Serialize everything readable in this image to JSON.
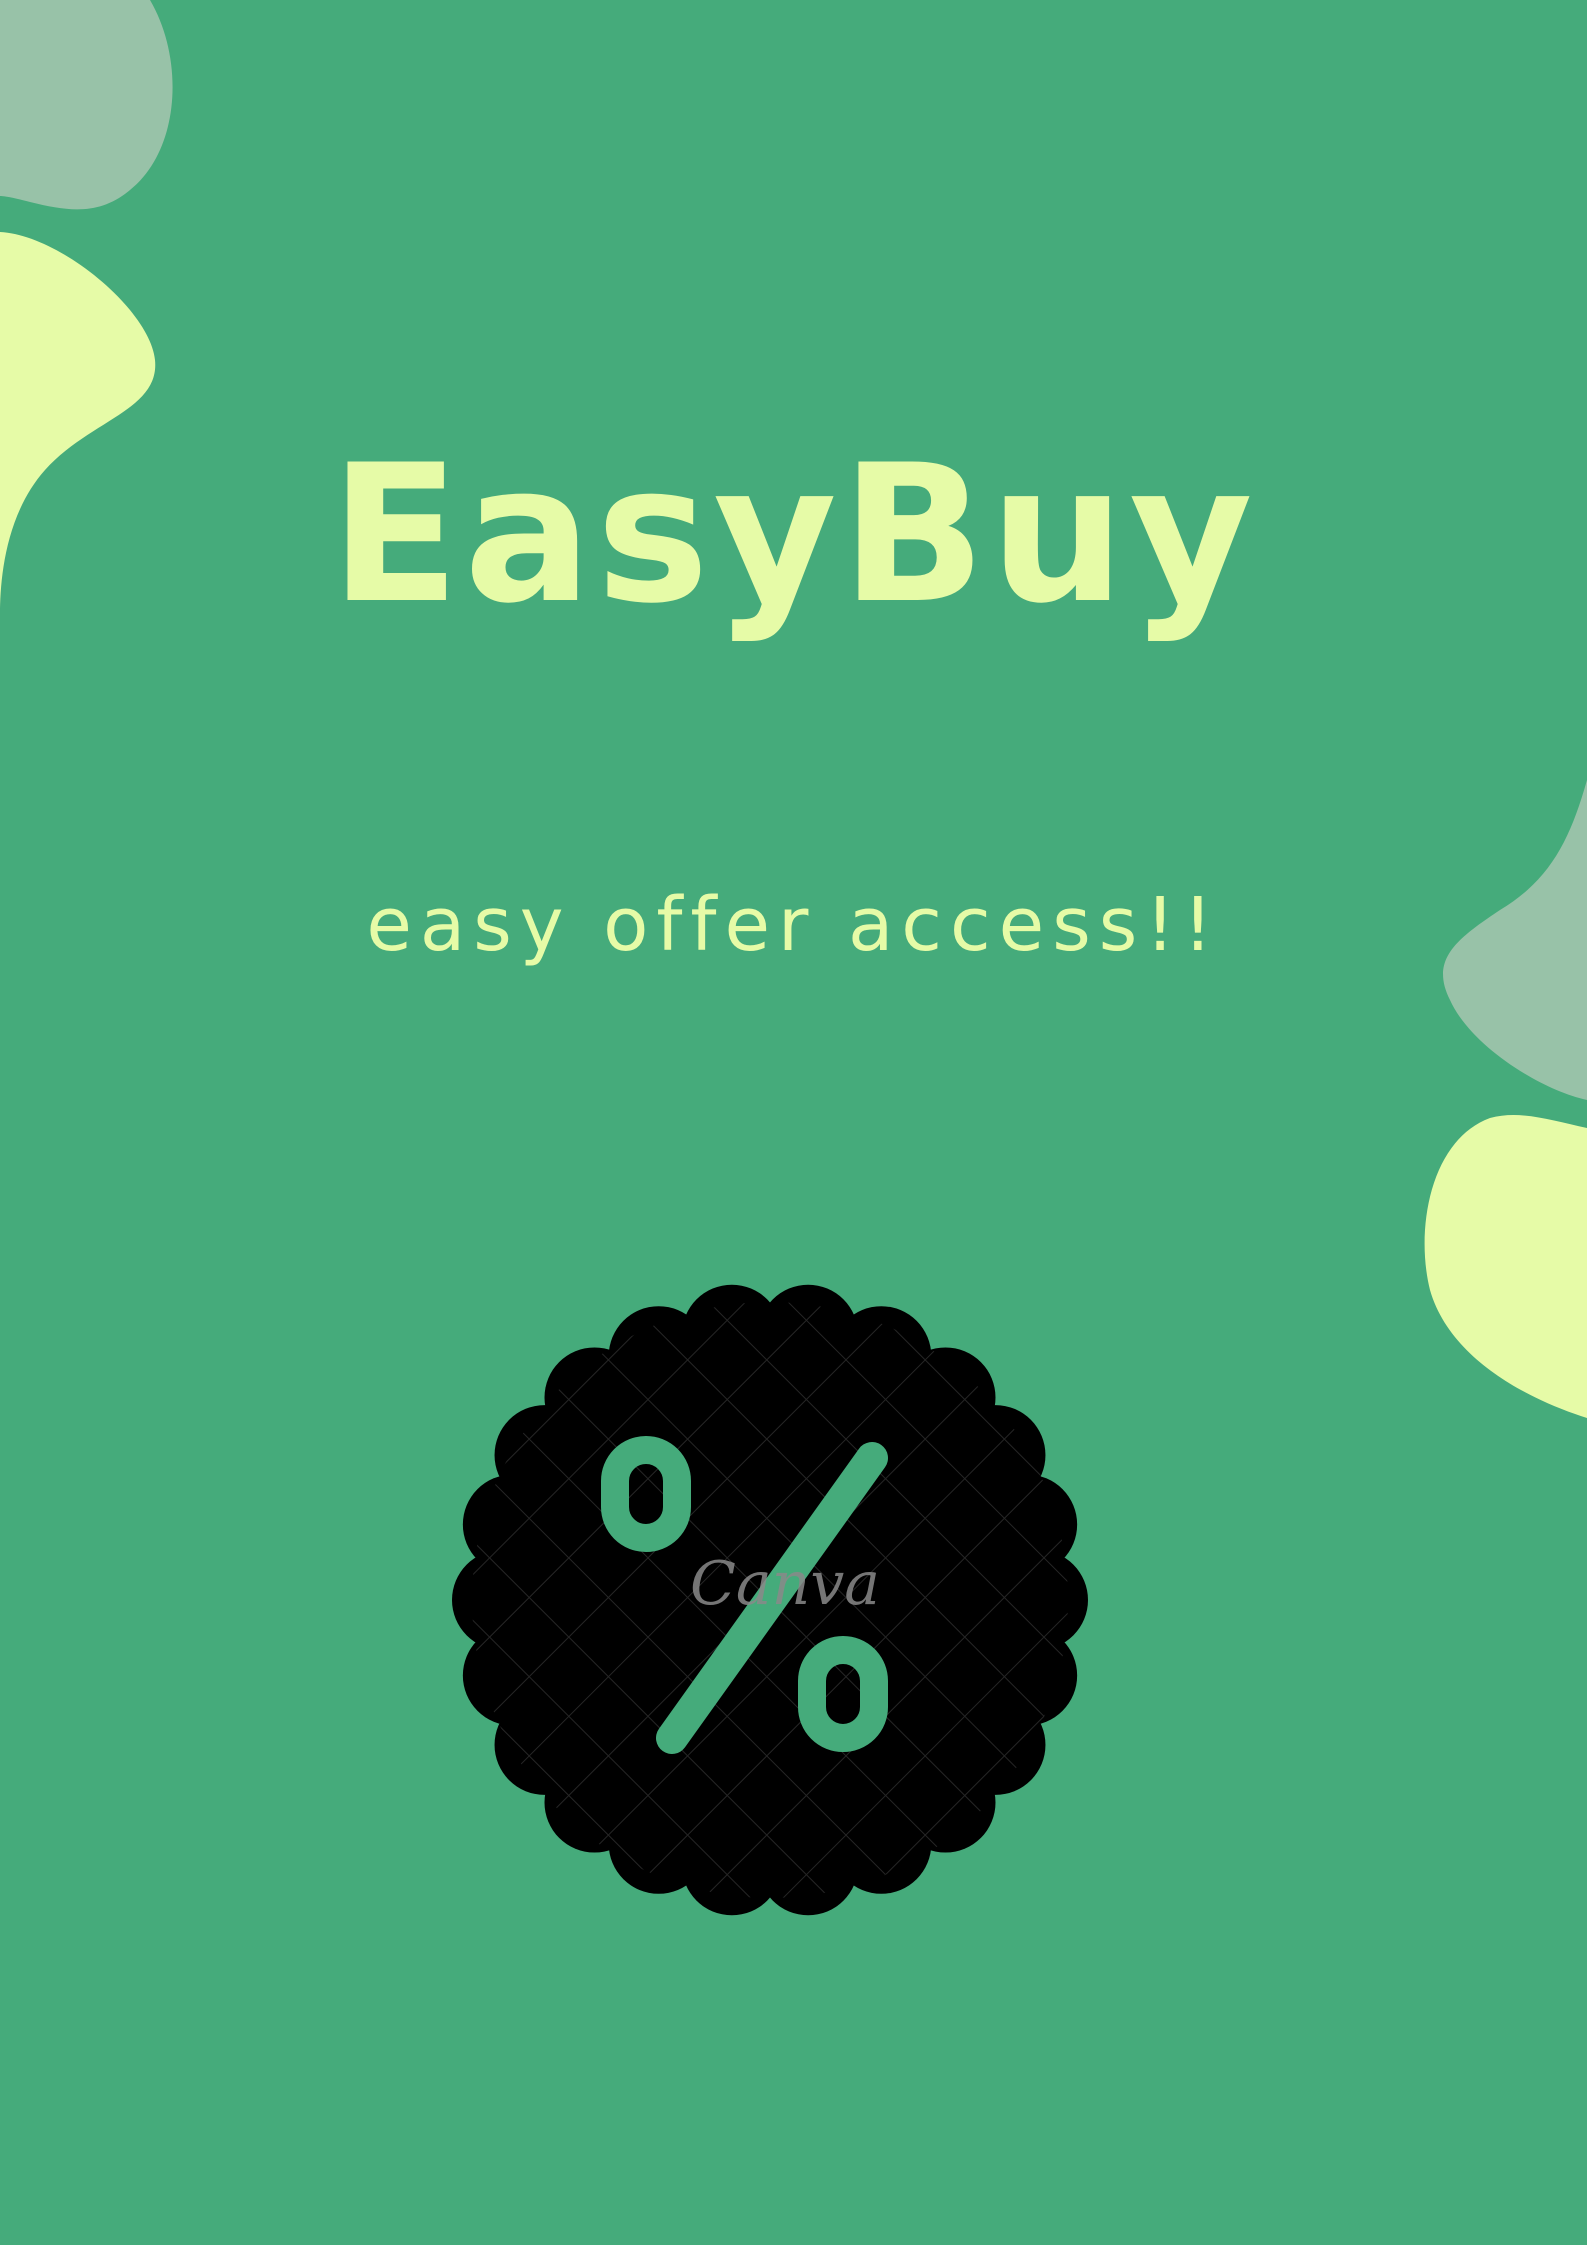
{
  "poster": {
    "title": "EasyBuy",
    "tagline": "easy offer access!!",
    "badge_symbol": "%",
    "watermark": "Canva"
  },
  "colors": {
    "background": "#45ab7b",
    "accent_yellow": "#e6fba7",
    "accent_sage": "#98c2a8",
    "badge": "#000000"
  },
  "icons": {
    "badge": "scalloped-percent-badge-icon"
  }
}
